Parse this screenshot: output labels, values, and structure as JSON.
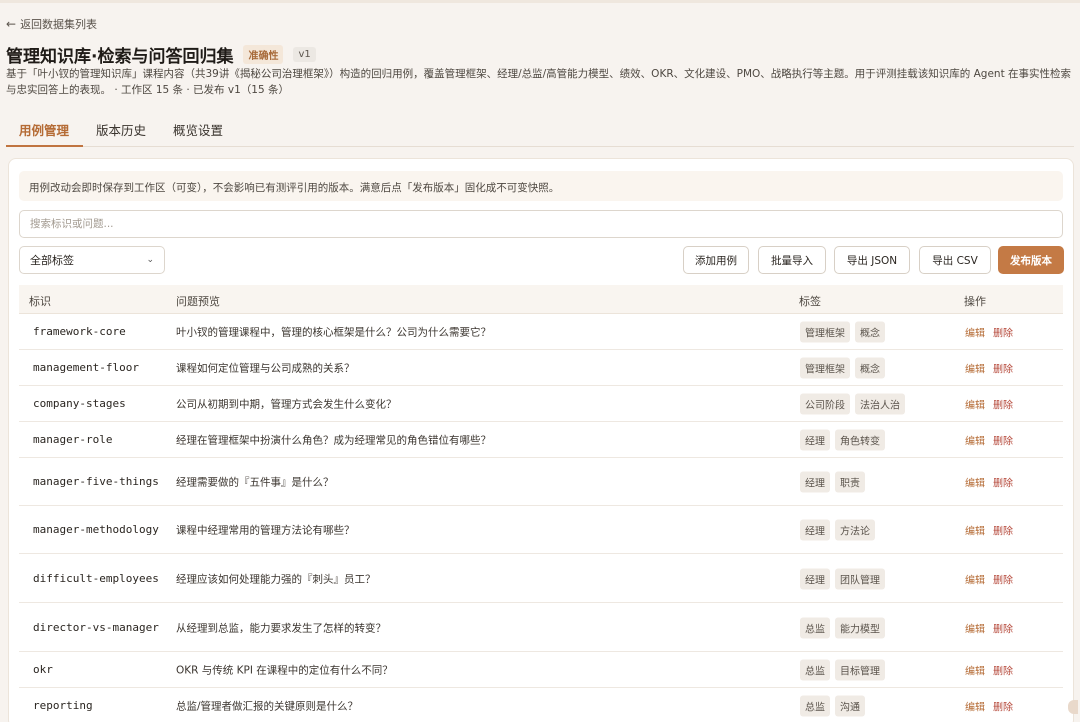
{
  "nav": {
    "back_label": "返回数据集列表"
  },
  "header": {
    "title": "管理知识库·检索与问答回归集",
    "badge": "准确性",
    "version": "v1",
    "description": "基于「叶小钗的管理知识库」课程内容（共39讲《揭秘公司治理框架》）构造的回归用例，覆盖管理框架、经理/总监/高管能力模型、绩效、OKR、文化建设、PMO、战略执行等主题。用于评测挂载该知识库的 Agent 在事实性检索与忠实回答上的表现。 · 工作区 15 条 · 已发布 v1（15 条）"
  },
  "tabs": [
    {
      "label": "用例管理",
      "active": true
    },
    {
      "label": "版本历史",
      "active": false
    },
    {
      "label": "概览设置",
      "active": false
    }
  ],
  "notice": "用例改动会即时保存到工作区（可变），不会影响已有测评引用的版本。满意后点「发布版本」固化成不可变快照。",
  "search": {
    "placeholder": "搜索标识或问题..."
  },
  "filter": {
    "selected": "全部标签"
  },
  "toolbar": {
    "add_label": "添加用例",
    "import_label": "批量导入",
    "export_json_label": "导出 JSON",
    "export_csv_label": "导出 CSV",
    "publish_label": "发布版本"
  },
  "table": {
    "headers": [
      "标识",
      "问题预览",
      "标签",
      "操作"
    ],
    "edit_label": "编辑",
    "delete_label": "删除",
    "rows": [
      {
        "id": "framework-core",
        "question": "叶小钗的管理课程中，管理的核心框架是什么？公司为什么需要它？",
        "tags": [
          "管理框架",
          "概念"
        ]
      },
      {
        "id": "management-floor",
        "question": "课程如何定位管理与公司成熟的关系？",
        "tags": [
          "管理框架",
          "概念"
        ]
      },
      {
        "id": "company-stages",
        "question": "公司从初期到中期，管理方式会发生什么变化？",
        "tags": [
          "公司阶段",
          "法治人治"
        ]
      },
      {
        "id": "manager-role",
        "question": "经理在管理框架中扮演什么角色？成为经理常见的角色错位有哪些？",
        "tags": [
          "经理",
          "角色转变"
        ]
      },
      {
        "id": "manager-five-things",
        "question": "经理需要做的『五件事』是什么？",
        "tags": [
          "经理",
          "职责"
        ]
      },
      {
        "id": "manager-methodology",
        "question": "课程中经理常用的管理方法论有哪些？",
        "tags": [
          "经理",
          "方法论"
        ]
      },
      {
        "id": "difficult-employees",
        "question": "经理应该如何处理能力强的『刺头』员工？",
        "tags": [
          "经理",
          "团队管理"
        ]
      },
      {
        "id": "director-vs-manager",
        "question": "从经理到总监，能力要求发生了怎样的转变？",
        "tags": [
          "总监",
          "能力模型"
        ]
      },
      {
        "id": "okr",
        "question": "OKR 与传统 KPI 在课程中的定位有什么不同？",
        "tags": [
          "总监",
          "目标管理"
        ]
      },
      {
        "id": "reporting",
        "question": "总监/管理者做汇报的关键原则是什么？",
        "tags": [
          "总监",
          "沟通"
        ]
      }
    ]
  }
}
